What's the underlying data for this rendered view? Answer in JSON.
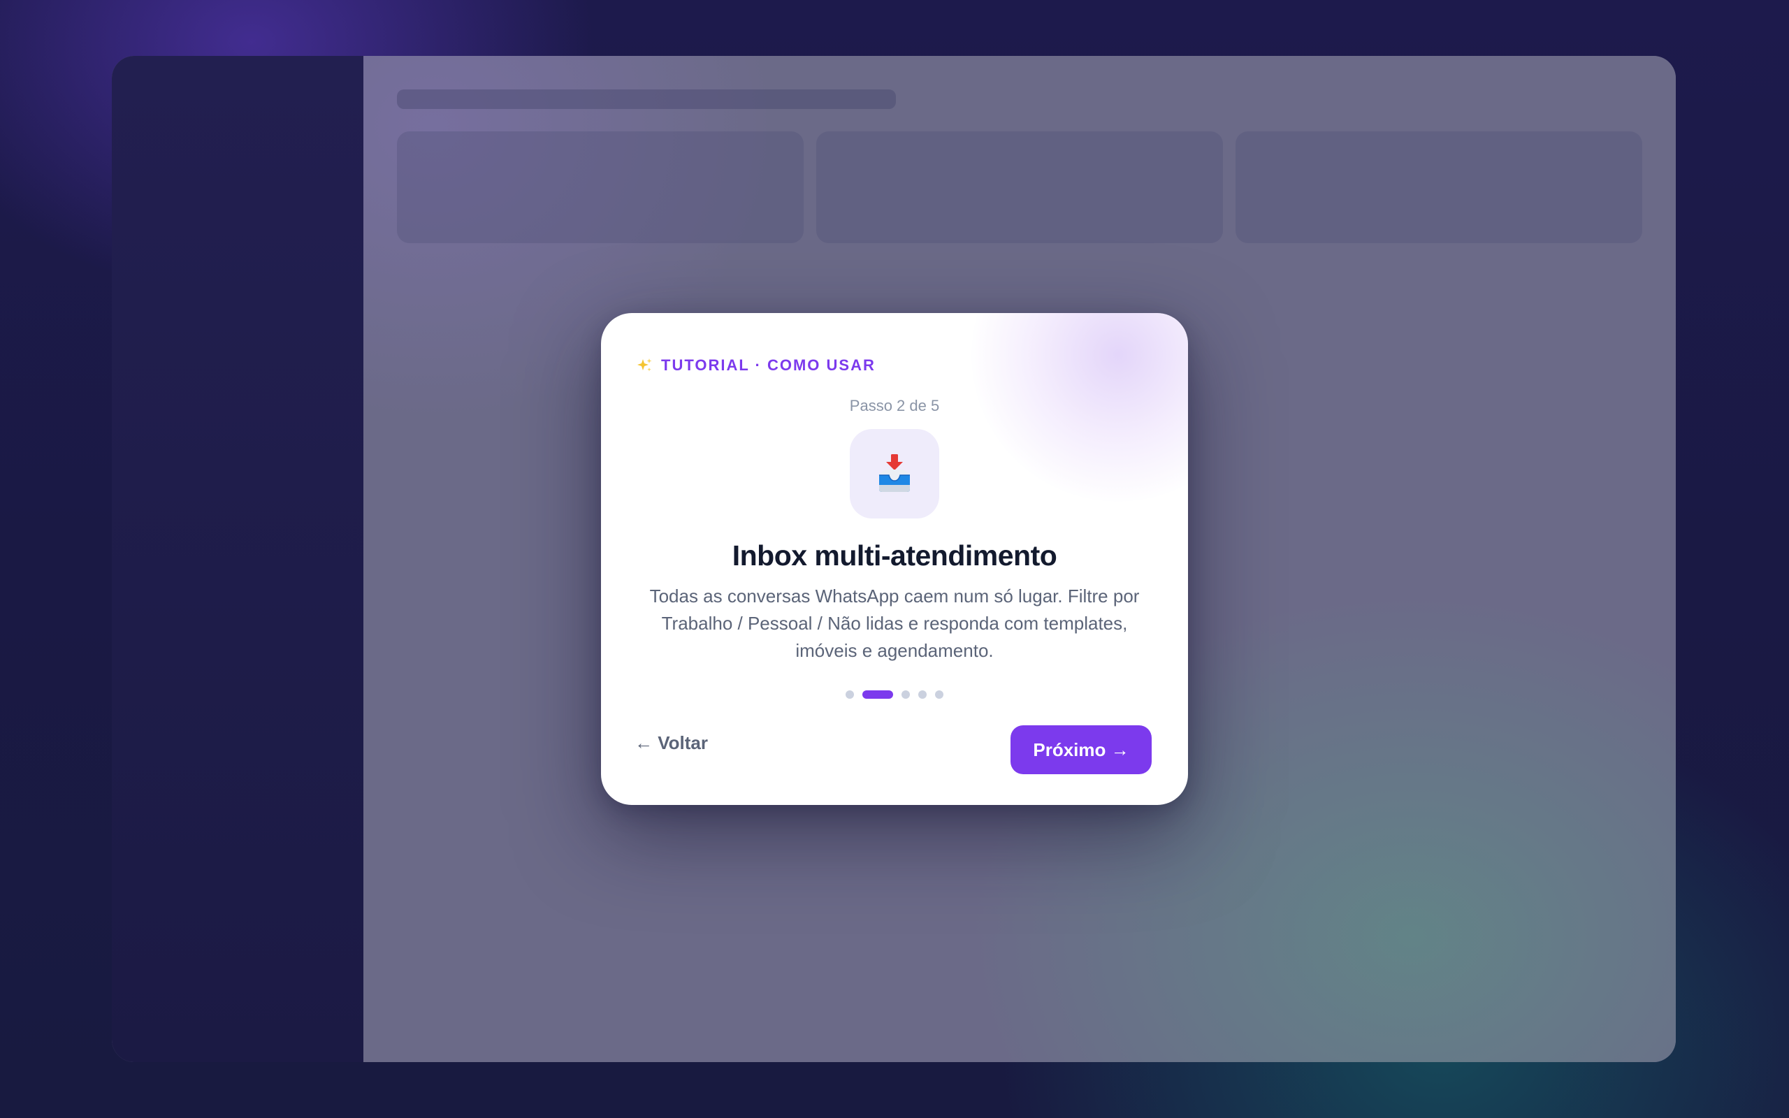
{
  "tutorial": {
    "eyebrow_icon": "sparkles-icon",
    "eyebrow": "TUTORIAL · COMO USAR",
    "step_label": "Passo 2 de 5",
    "current_step": 2,
    "total_steps": 5,
    "step_icon": "inbox-tray-icon",
    "title": "Inbox multi-atendimento",
    "description": "Todas as conversas WhatsApp caem num só lugar. Filtre por Trabalho / Pessoal / Não lidas e responda com templates, imóveis e agendamento.",
    "back_label": "← Voltar",
    "next_label": "Próximo →"
  },
  "colors": {
    "accent": "#7c3aed",
    "title": "#131a2e",
    "body_text": "#5b6478",
    "dot_inactive": "#cbd1df",
    "icon_tile": "#efecfb"
  }
}
